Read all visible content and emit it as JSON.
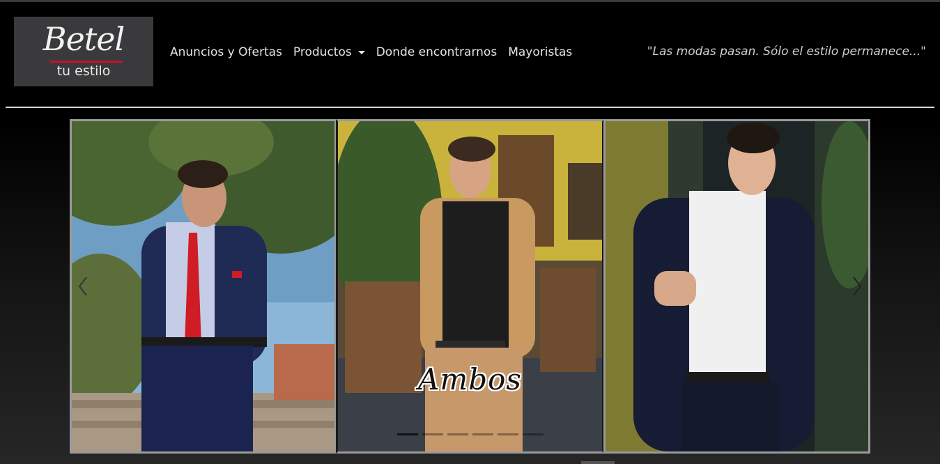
{
  "brand": {
    "logo_main": "Betel",
    "logo_sub": "tu estilo",
    "accent_color": "#c8102e"
  },
  "nav": {
    "items": [
      {
        "label": "Anuncios y Ofertas"
      },
      {
        "label": "Productos",
        "has_dropdown": true
      },
      {
        "label": "Donde encontrarnos"
      },
      {
        "label": "Mayoristas"
      }
    ]
  },
  "tagline": "\"Las modas pasan. Sólo el estilo permanece...\"",
  "carousel": {
    "caption": "Ambos",
    "active_indicator": 1,
    "indicator_count": 6,
    "prev_icon": "chevron-left-icon",
    "next_icon": "chevron-right-icon"
  }
}
